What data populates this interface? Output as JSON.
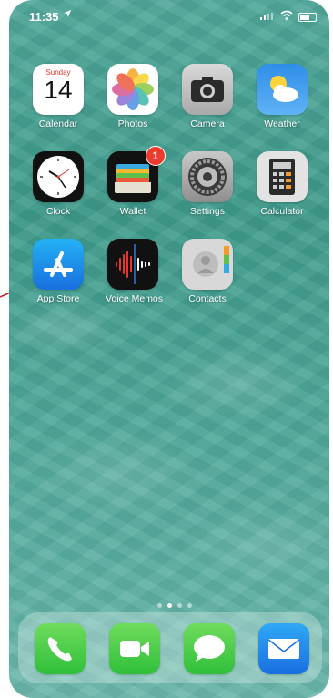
{
  "status_bar": {
    "time": "11:35"
  },
  "apps": [
    {
      "key": "calendar",
      "label": "Calendar",
      "day_name": "Sunday",
      "day_number": "14"
    },
    {
      "key": "photos",
      "label": "Photos"
    },
    {
      "key": "camera",
      "label": "Camera"
    },
    {
      "key": "weather",
      "label": "Weather"
    },
    {
      "key": "clock",
      "label": "Clock"
    },
    {
      "key": "wallet",
      "label": "Wallet",
      "badge": "1"
    },
    {
      "key": "settings",
      "label": "Settings"
    },
    {
      "key": "calculator",
      "label": "Calculator"
    },
    {
      "key": "appstore",
      "label": "App Store"
    },
    {
      "key": "voicememos",
      "label": "Voice Memos"
    },
    {
      "key": "contacts",
      "label": "Contacts"
    }
  ],
  "dock": [
    "Phone",
    "FaceTime",
    "Messages",
    "Mail"
  ],
  "page_indicator": {
    "pages": 4,
    "current": 1
  },
  "colors": {
    "badge": "#ee3b30",
    "annotation_arrow": "#c0242b"
  }
}
